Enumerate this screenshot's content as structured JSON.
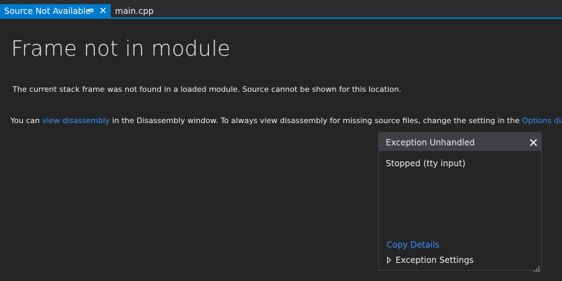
{
  "tabs": [
    {
      "label": "Source Not Available",
      "active": true,
      "pin_icon": "pin-icon",
      "close_icon": "close-icon"
    },
    {
      "label": "main.cpp",
      "active": false
    }
  ],
  "colors": {
    "accent": "#007acc",
    "link": "#3794ff",
    "background": "#1e1e1e",
    "popup_header": "#3f3f46"
  },
  "page": {
    "title": "Frame not in module",
    "message1": "The current stack frame was not found in a loaded module. Source cannot be shown for this location.",
    "message2_before": "You can ",
    "message2_link1": "view disassembly",
    "message2_middle": " in the Disassembly window. To always view disassembly for missing source files, change the setting in the ",
    "message2_link2": "Options dialog",
    "message2_after": "."
  },
  "exception_popup": {
    "title": "Exception Unhandled",
    "message": "Stopped (tty input)",
    "copy_details": "Copy Details",
    "settings": "Exception Settings",
    "close_icon": "close-icon",
    "expander_icon": "triangle-right-icon",
    "grip_icon": "resize-grip-icon"
  }
}
